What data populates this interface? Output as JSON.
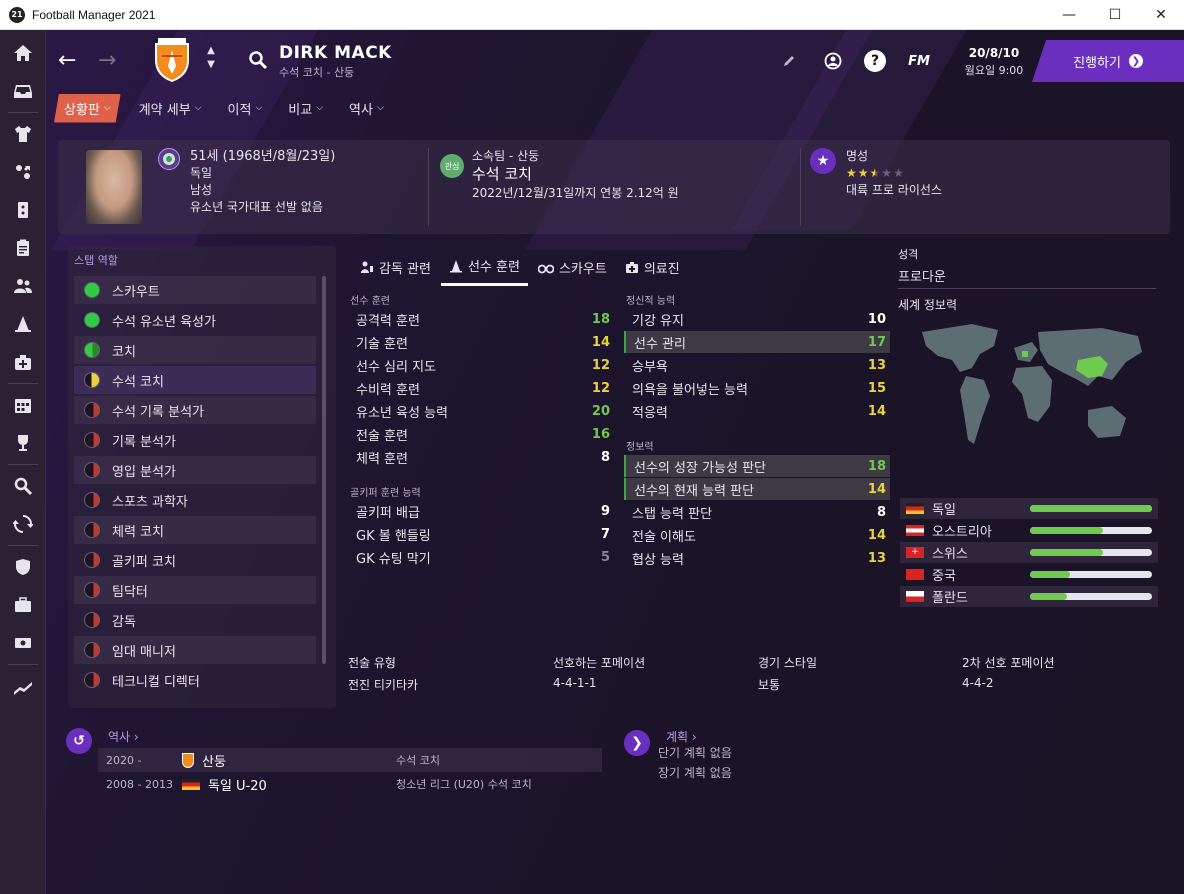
{
  "window": {
    "title": "Football Manager 2021",
    "logo_text": "21",
    "minimize": "—",
    "maximize": "☐",
    "close": "✕"
  },
  "header": {
    "name": "DIRK MACK",
    "subtitle": "수석 코치 - 산둥",
    "date": "20/8/10",
    "day_time": "월요일 9:00",
    "continue_label": "진행하기",
    "fm_label": "FM",
    "help_label": "?"
  },
  "subnav": [
    {
      "label": "상황판",
      "active": true
    },
    {
      "label": "계약 세부",
      "active": false
    },
    {
      "label": "이적",
      "active": false
    },
    {
      "label": "비교",
      "active": false
    },
    {
      "label": "역사",
      "active": false
    }
  ],
  "profile": {
    "age_line": "51세 (1968년/8월/23일)",
    "nation": "독일",
    "gender": "남성",
    "youth_caps": "유소년 국가대표 선발 없음",
    "interest_badge": "관심",
    "club_label": "소속팀 - 산둥",
    "role": "수석 코치",
    "contract": "2022년/12월/31일까지 연봉 2.12억 원",
    "reputation_label": "명성",
    "reputation_stars": 2.5,
    "license": "대륙 프로 라이선스"
  },
  "roles": {
    "title": "스탭 역할",
    "items": [
      {
        "label": "스카우트",
        "rating": 1.0
      },
      {
        "label": "수석 유소년 육성가",
        "rating": 1.0
      },
      {
        "label": "코치",
        "rating": 0.9
      },
      {
        "label": "수석 코치",
        "rating": 0.5
      },
      {
        "label": "수석 기록 분석가",
        "rating": 0.2
      },
      {
        "label": "기록 분석가",
        "rating": 0.2
      },
      {
        "label": "영입 분석가",
        "rating": 0.2
      },
      {
        "label": "스포츠 과학자",
        "rating": 0.2
      },
      {
        "label": "체력 코치",
        "rating": 0.2
      },
      {
        "label": "골키퍼 코치",
        "rating": 0.2
      },
      {
        "label": "팀닥터",
        "rating": 0.2
      },
      {
        "label": "감독",
        "rating": 0.2
      },
      {
        "label": "임대 매니저",
        "rating": 0.2
      },
      {
        "label": "테크니컬 디렉터",
        "rating": 0.2
      }
    ]
  },
  "tabs": [
    {
      "label": "감독 관련",
      "icon": "manager-icon",
      "active": false
    },
    {
      "label": "선수 훈련",
      "icon": "training-cone-icon",
      "active": true
    },
    {
      "label": "스카우트",
      "icon": "binoculars-icon",
      "active": false
    },
    {
      "label": "의료진",
      "icon": "medical-kit-icon",
      "active": false
    }
  ],
  "coaching": {
    "title": "선수 훈련",
    "items": [
      {
        "label": "공격력 훈련",
        "value": "18"
      },
      {
        "label": "기술 훈련",
        "value": "14"
      },
      {
        "label": "선수 심리 지도",
        "value": "12"
      },
      {
        "label": "수비력 훈련",
        "value": "12"
      },
      {
        "label": "유소년 육성 능력",
        "value": "20"
      },
      {
        "label": "전술 훈련",
        "value": "16"
      },
      {
        "label": "체력 훈련",
        "value": "8"
      }
    ]
  },
  "gk_coaching": {
    "title": "골키퍼 훈련 능력",
    "items": [
      {
        "label": "골키퍼 배급",
        "value": "9"
      },
      {
        "label": "GK 볼 핸들링",
        "value": "7"
      },
      {
        "label": "GK 슈팅 막기",
        "value": "5"
      }
    ]
  },
  "mental": {
    "title": "정신적 능력",
    "items": [
      {
        "label": "기강 유지",
        "value": "10",
        "highlight": false
      },
      {
        "label": "선수 관리",
        "value": "17",
        "highlight": true
      },
      {
        "label": "승부욕",
        "value": "13",
        "highlight": false
      },
      {
        "label": "의욕을 불어넣는 능력",
        "value": "15",
        "highlight": false
      },
      {
        "label": "적응력",
        "value": "14",
        "highlight": false
      }
    ]
  },
  "knowledge": {
    "title": "정보력",
    "items": [
      {
        "label": "선수의 성장 가능성 판단",
        "value": "18",
        "highlight": true
      },
      {
        "label": "선수의 현재 능력 판단",
        "value": "14",
        "highlight": true
      },
      {
        "label": "스탭 능력 판단",
        "value": "8",
        "highlight": false
      },
      {
        "label": "전술 이해도",
        "value": "14",
        "highlight": false
      },
      {
        "label": "협상 능력",
        "value": "13",
        "highlight": false
      }
    ]
  },
  "personality": {
    "label": "성격",
    "value": "프로다운"
  },
  "world_knowledge": {
    "title": "세계 정보력",
    "nations": [
      {
        "name": "독일",
        "level": 1.0,
        "flag": "germany-flag"
      },
      {
        "name": "오스트리아",
        "level": 0.6,
        "flag": "austria-flag"
      },
      {
        "name": "스위스",
        "level": 0.6,
        "flag": "switzerland-flag"
      },
      {
        "name": "중국",
        "level": 0.33,
        "flag": "china-flag"
      },
      {
        "name": "폴란드",
        "level": 0.3,
        "flag": "poland-flag"
      }
    ]
  },
  "tactics": [
    {
      "label": "전술 유형",
      "value": "전진 티키타카"
    },
    {
      "label": "선호하는 포메이션",
      "value": "4-4-1-1"
    },
    {
      "label": "경기 스타일",
      "value": "보통"
    },
    {
      "label": "2차 선호 포메이션",
      "value": "4-4-2"
    }
  ],
  "history": {
    "title": "역사",
    "rows": [
      {
        "years": "2020 -",
        "team": "산둥",
        "role": "수석 코치",
        "badge": "shandong-crest"
      },
      {
        "years": "2008 - 2013",
        "team": "독일 U-20",
        "role": "청소년 리그 (U20) 수석 코치",
        "badge": "germany-flag"
      }
    ]
  },
  "plans": {
    "title": "계획",
    "short_term": "단기 계획 없음",
    "long_term": "장기 계획 없음"
  },
  "colors": {
    "accent": "#6b2fc0",
    "active_tab": "#e0614a",
    "green_value": "#6fca50",
    "yellow_value": "#e8d43a",
    "white_value": "#ffffff",
    "grey_value": "#8a8296"
  }
}
